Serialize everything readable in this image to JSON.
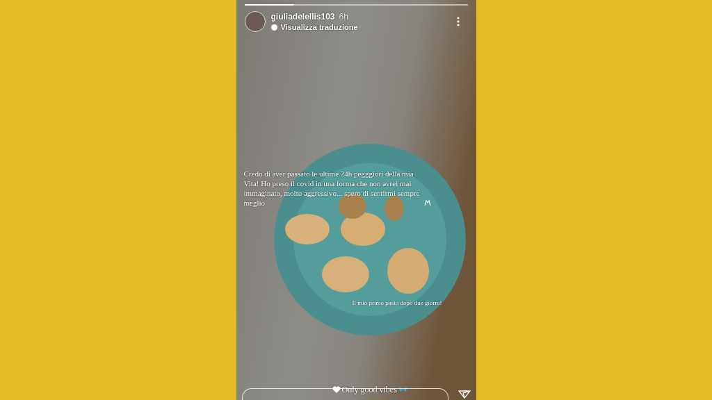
{
  "story": {
    "progress": {
      "level": 0.22
    },
    "user": {
      "username": "giuliadelellis103",
      "time": "6h",
      "translation": "Visualizza traduzione"
    },
    "captions": [
      {
        "text": "Credo di aver passato le ultime 24h pegggiori della mia Vita! Ho preso il covid in una  forma che non avrei mai immaginato, molto aggressivo... spero di sentirmi sempre meglio"
      },
      {
        "text": "Il mio primo pasto dopo due giorni!"
      }
    ],
    "sticker": {
      "text": "Only good vibes"
    }
  }
}
